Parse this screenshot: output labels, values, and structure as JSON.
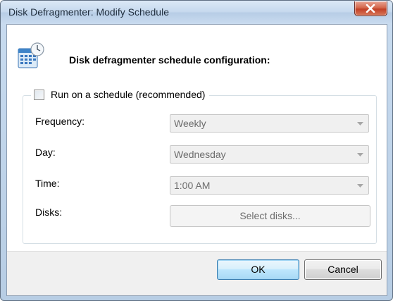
{
  "window": {
    "title": "Disk Defragmenter: Modify Schedule",
    "close_icon": "close-icon"
  },
  "header": {
    "icon": "calendar-clock-icon",
    "text": "Disk defragmenter schedule configuration:"
  },
  "schedule": {
    "run_on_schedule_label": "Run on a schedule (recommended)",
    "run_on_schedule_checked": false,
    "frequency_label": "Frequency:",
    "frequency_value": "Weekly",
    "day_label": "Day:",
    "day_value": "Wednesday",
    "time_label": "Time:",
    "time_value": "1:00 AM",
    "disks_label": "Disks:",
    "select_disks_label": "Select disks..."
  },
  "footer": {
    "ok_label": "OK",
    "cancel_label": "Cancel"
  },
  "colors": {
    "title_bar": "#c6d9ee",
    "close_button": "#c24127",
    "ok_button_border": "#3c7fb1",
    "disabled_text": "#6d6d6d"
  }
}
